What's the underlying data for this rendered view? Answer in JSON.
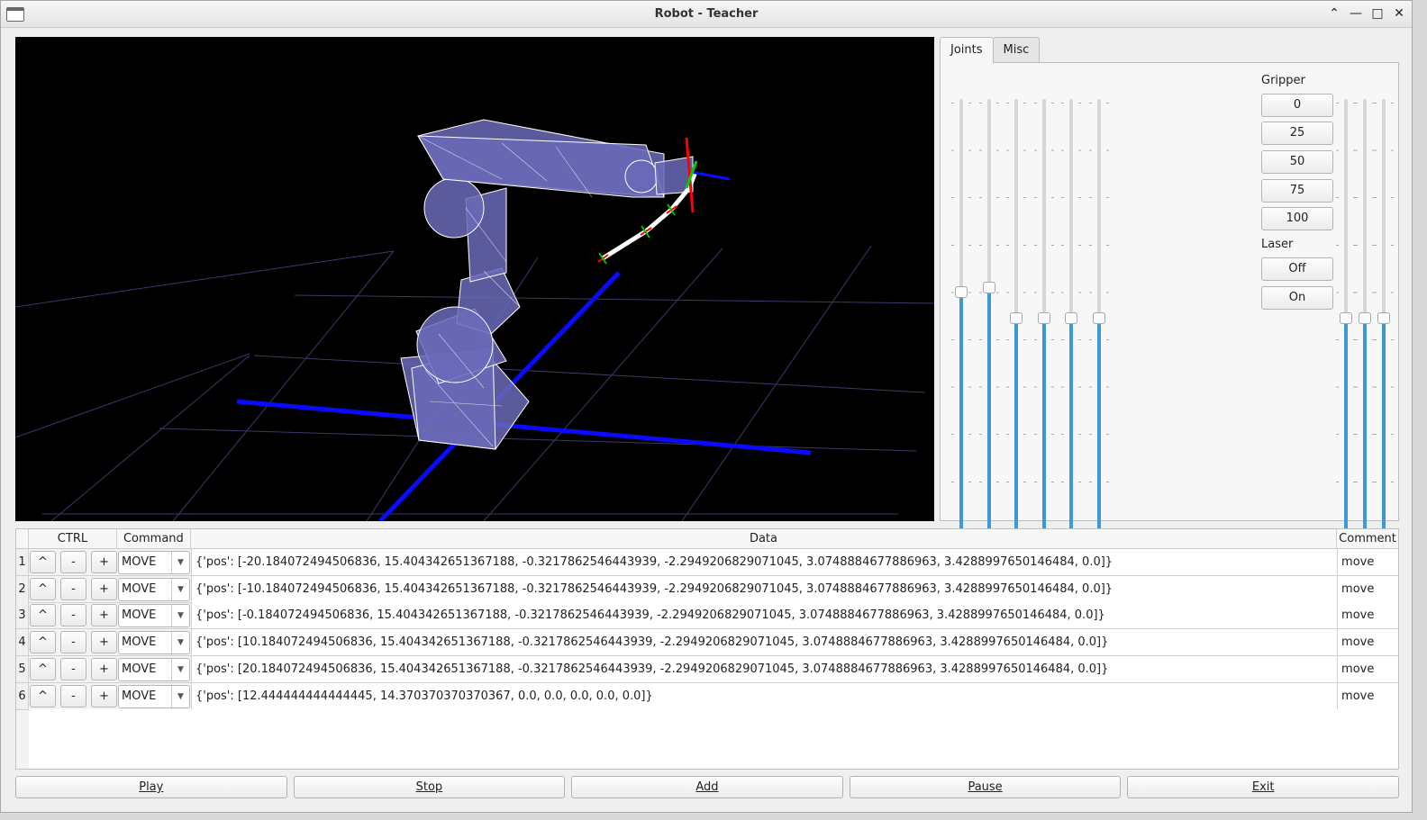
{
  "window": {
    "title": "Robot - Teacher"
  },
  "panel": {
    "tabs": [
      {
        "label": "Joints"
      },
      {
        "label": "Misc"
      }
    ],
    "joint_sliders": [
      {
        "level": 0.56
      },
      {
        "level": 0.57
      },
      {
        "level": 0.5
      },
      {
        "level": 0.5
      },
      {
        "level": 0.5
      },
      {
        "level": 0.5
      }
    ],
    "gripper": {
      "label": "Gripper",
      "buttons": [
        "0",
        "25",
        "50",
        "75",
        "100"
      ]
    },
    "laser": {
      "label": "Laser",
      "buttons": [
        "Off",
        "On"
      ]
    },
    "extra_sliders": [
      {
        "level": 0.5
      },
      {
        "level": 0.5
      },
      {
        "level": 0.5
      }
    ]
  },
  "table": {
    "headers": {
      "ctrl": "CTRL",
      "command": "Command",
      "data": "Data",
      "comment": "Comment"
    },
    "ctrl_labels": {
      "up": "^",
      "minus": "-",
      "plus": "+"
    },
    "rows": [
      {
        "num": "1",
        "command": "MOVE",
        "data": "{'pos': [-20.184072494506836, 15.404342651367188, -0.3217862546443939, -2.2949206829071045, 3.0748884677886963, 3.4288997650146484, 0.0]}",
        "comment": "move"
      },
      {
        "num": "2",
        "command": "MOVE",
        "data": "{'pos': [-10.184072494506836, 15.404342651367188, -0.3217862546443939, -2.2949206829071045, 3.0748884677886963, 3.4288997650146484, 0.0]}",
        "comment": "move"
      },
      {
        "num": "3",
        "command": "MOVE",
        "data": "{'pos': [-0.184072494506836, 15.404342651367188, -0.3217862546443939, -2.2949206829071045, 3.0748884677886963, 3.4288997650146484, 0.0]}",
        "comment": "move"
      },
      {
        "num": "4",
        "command": "MOVE",
        "data": "{'pos': [10.184072494506836, 15.404342651367188, -0.3217862546443939, -2.2949206829071045, 3.0748884677886963, 3.4288997650146484, 0.0]}",
        "comment": "move"
      },
      {
        "num": "5",
        "command": "MOVE",
        "data": "{'pos': [20.184072494506836, 15.404342651367188, -0.3217862546443939, -2.2949206829071045, 3.0748884677886963, 3.4288997650146484, 0.0]}",
        "comment": "move"
      },
      {
        "num": "6",
        "command": "MOVE",
        "data": "{'pos': [12.444444444444445, 14.370370370370367, 0.0, 0.0, 0.0, 0.0, 0.0]}",
        "comment": "move"
      }
    ]
  },
  "buttons": {
    "play": "Play",
    "stop": "Stop",
    "add": "Add",
    "pause": "Pause",
    "exit": "Exit"
  },
  "colors": {
    "slider_fill": "#3d99d6",
    "viewport_bg": "#000000",
    "robot_fill": "#6b6bb0",
    "axis_blue": "#0000ff"
  }
}
